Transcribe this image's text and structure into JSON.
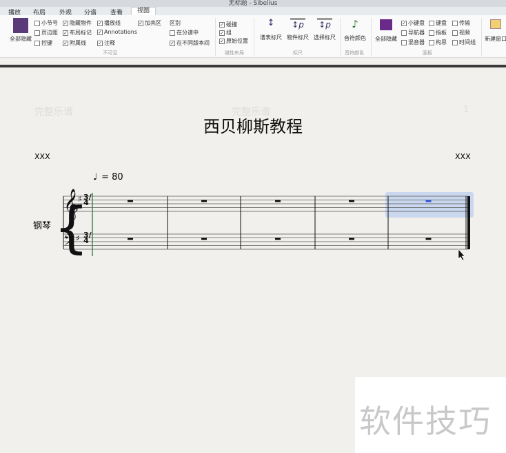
{
  "window": {
    "title": "无标题 - Sibelius"
  },
  "tabs": [
    "播放",
    "布局",
    "外观",
    "分谱",
    "查看",
    "视图"
  ],
  "active_tab": "视图",
  "ribbon": {
    "hide_all": "全部隐藏",
    "invisible": {
      "label": "不可见",
      "items": [
        {
          "label": "小节号",
          "checked": false
        },
        {
          "label": "页边距",
          "checked": false
        },
        {
          "label": "控键",
          "checked": false
        },
        {
          "label": "隐藏物件",
          "checked": true
        },
        {
          "label": "布局标记",
          "checked": true
        },
        {
          "label": "附属线",
          "checked": true
        },
        {
          "label": "播放线",
          "checked": true
        },
        {
          "label": "Annotations",
          "checked": true
        },
        {
          "label": "注释",
          "checked": true
        },
        {
          "label": "加亮区",
          "checked": true
        }
      ]
    },
    "diff": {
      "label": "区别",
      "items": [
        {
          "label": "在分谱中",
          "checked": false
        },
        {
          "label": "在不同版本间",
          "checked": true
        }
      ]
    },
    "magnetic": {
      "label": "磁性布局",
      "items": [
        {
          "label": "碰撞",
          "checked": true
        },
        {
          "label": "组",
          "checked": true
        },
        {
          "label": "原始位置",
          "checked": true
        }
      ]
    },
    "rulers": {
      "label": "标尺",
      "items": [
        "谱表标尺",
        "物件标尺",
        "选择标尺"
      ]
    },
    "note_colors": {
      "label": "音符颜色",
      "button": "音符颜色"
    },
    "panels": {
      "label": "面板",
      "hide_all": "全部隐藏",
      "color": "#6a2a8a",
      "items": [
        {
          "label": "小键盘",
          "checked": true
        },
        {
          "label": "导航器",
          "checked": false
        },
        {
          "label": "混音器",
          "checked": false
        },
        {
          "label": "键盘",
          "checked": false
        },
        {
          "label": "指板",
          "checked": false
        },
        {
          "label": "构思",
          "checked": false
        },
        {
          "label": "传输",
          "checked": false
        },
        {
          "label": "视频",
          "checked": false
        },
        {
          "label": "时间线",
          "checked": false
        }
      ]
    },
    "new_window": "新建窗口"
  },
  "score": {
    "header_left": "完整乐谱",
    "header_center": "完整乐谱",
    "page_number": "1",
    "title": "西贝柳斯教程",
    "composer_left": "XXX",
    "composer_right": "XXX",
    "tempo": "= 80",
    "instrument": "钢琴",
    "time_signature": "3/4",
    "key": "G major (1 sharp)",
    "measures": 5
  },
  "watermark": "软件技巧"
}
